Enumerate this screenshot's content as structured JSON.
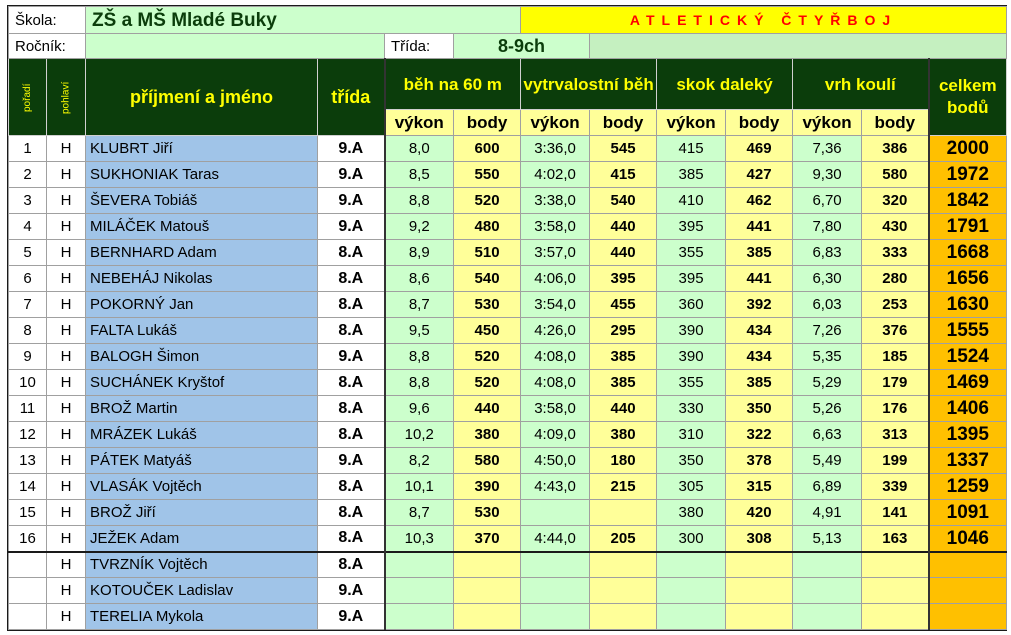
{
  "header": {
    "school_label": "Škola:",
    "school_name": "ZŠ a MŠ Mladé Buky",
    "title": "ATLETICKÝ ČTYŘBOJ",
    "year_label": "Ročník:",
    "class_label": "Třída:",
    "class_value": "8-9ch"
  },
  "columns": {
    "rank": "pořadí",
    "sex": "pohlaví",
    "name": "příjmení a jméno",
    "class": "třída",
    "ev1": "běh na 60 m",
    "ev2": "vytrvalostní běh",
    "ev3": "skok daleký",
    "ev4": "vrh koulí",
    "total": "celkem bodů",
    "perf": "výkon",
    "pts": "body"
  },
  "rows": [
    {
      "rank": "1",
      "sex": "H",
      "name": "KLUBRT Jiří",
      "cls": "9.A",
      "p1": "8,0",
      "b1": "600",
      "p2": "3:36,0",
      "b2": "545",
      "p3": "415",
      "b3": "469",
      "p4": "7,36",
      "b4": "386",
      "total": "2000"
    },
    {
      "rank": "2",
      "sex": "H",
      "name": "SUKHONIAK Taras",
      "cls": "9.A",
      "p1": "8,5",
      "b1": "550",
      "p2": "4:02,0",
      "b2": "415",
      "p3": "385",
      "b3": "427",
      "p4": "9,30",
      "b4": "580",
      "total": "1972"
    },
    {
      "rank": "3",
      "sex": "H",
      "name": "ŠEVERA Tobiáš",
      "cls": "9.A",
      "p1": "8,8",
      "b1": "520",
      "p2": "3:38,0",
      "b2": "540",
      "p3": "410",
      "b3": "462",
      "p4": "6,70",
      "b4": "320",
      "total": "1842"
    },
    {
      "rank": "4",
      "sex": "H",
      "name": "MILÁČEK Matouš",
      "cls": "9.A",
      "p1": "9,2",
      "b1": "480",
      "p2": "3:58,0",
      "b2": "440",
      "p3": "395",
      "b3": "441",
      "p4": "7,80",
      "b4": "430",
      "total": "1791"
    },
    {
      "rank": "5",
      "sex": "H",
      "name": "BERNHARD Adam",
      "cls": "8.A",
      "p1": "8,9",
      "b1": "510",
      "p2": "3:57,0",
      "b2": "440",
      "p3": "355",
      "b3": "385",
      "p4": "6,83",
      "b4": "333",
      "total": "1668"
    },
    {
      "rank": "6",
      "sex": "H",
      "name": "NEBEHÁJ Nikolas",
      "cls": "8.A",
      "p1": "8,6",
      "b1": "540",
      "p2": "4:06,0",
      "b2": "395",
      "p3": "395",
      "b3": "441",
      "p4": "6,30",
      "b4": "280",
      "total": "1656"
    },
    {
      "rank": "7",
      "sex": "H",
      "name": "POKORNÝ Jan",
      "cls": "8.A",
      "p1": "8,7",
      "b1": "530",
      "p2": "3:54,0",
      "b2": "455",
      "p3": "360",
      "b3": "392",
      "p4": "6,03",
      "b4": "253",
      "total": "1630"
    },
    {
      "rank": "8",
      "sex": "H",
      "name": "FALTA Lukáš",
      "cls": "8.A",
      "p1": "9,5",
      "b1": "450",
      "p2": "4:26,0",
      "b2": "295",
      "p3": "390",
      "b3": "434",
      "p4": "7,26",
      "b4": "376",
      "total": "1555"
    },
    {
      "rank": "9",
      "sex": "H",
      "name": "BALOGH Šimon",
      "cls": "9.A",
      "p1": "8,8",
      "b1": "520",
      "p2": "4:08,0",
      "b2": "385",
      "p3": "390",
      "b3": "434",
      "p4": "5,35",
      "b4": "185",
      "total": "1524"
    },
    {
      "rank": "10",
      "sex": "H",
      "name": "SUCHÁNEK Kryštof",
      "cls": "8.A",
      "p1": "8,8",
      "b1": "520",
      "p2": "4:08,0",
      "b2": "385",
      "p3": "355",
      "b3": "385",
      "p4": "5,29",
      "b4": "179",
      "total": "1469"
    },
    {
      "rank": "11",
      "sex": "H",
      "name": "BROŽ Martin",
      "cls": "8.A",
      "p1": "9,6",
      "b1": "440",
      "p2": "3:58,0",
      "b2": "440",
      "p3": "330",
      "b3": "350",
      "p4": "5,26",
      "b4": "176",
      "total": "1406"
    },
    {
      "rank": "12",
      "sex": "H",
      "name": "MRÁZEK Lukáš",
      "cls": "8.A",
      "p1": "10,2",
      "b1": "380",
      "p2": "4:09,0",
      "b2": "380",
      "p3": "310",
      "b3": "322",
      "p4": "6,63",
      "b4": "313",
      "total": "1395"
    },
    {
      "rank": "13",
      "sex": "H",
      "name": "PÁTEK Matyáš",
      "cls": "9.A",
      "p1": "8,2",
      "b1": "580",
      "p2": "4:50,0",
      "b2": "180",
      "p3": "350",
      "b3": "378",
      "p4": "5,49",
      "b4": "199",
      "total": "1337"
    },
    {
      "rank": "14",
      "sex": "H",
      "name": "VLASÁK Vojtěch",
      "cls": "8.A",
      "p1": "10,1",
      "b1": "390",
      "p2": "4:43,0",
      "b2": "215",
      "p3": "305",
      "b3": "315",
      "p4": "6,89",
      "b4": "339",
      "total": "1259"
    },
    {
      "rank": "15",
      "sex": "H",
      "name": "BROŽ Jiří",
      "cls": "8.A",
      "p1": "8,7",
      "b1": "530",
      "p2": "",
      "b2": "",
      "p3": "380",
      "b3": "420",
      "p4": "4,91",
      "b4": "141",
      "total": "1091"
    },
    {
      "rank": "16",
      "sex": "H",
      "name": "JEŽEK Adam",
      "cls": "8.A",
      "p1": "10,3",
      "b1": "370",
      "p2": "4:44,0",
      "b2": "205",
      "p3": "300",
      "b3": "308",
      "p4": "5,13",
      "b4": "163",
      "total": "1046"
    }
  ],
  "extra_rows": [
    {
      "rank": "",
      "sex": "H",
      "name": "TVRZNÍK Vojtěch",
      "cls": "8.A"
    },
    {
      "rank": "",
      "sex": "H",
      "name": "KOTOUČEK Ladislav",
      "cls": "9.A"
    },
    {
      "rank": "",
      "sex": "H",
      "name": "TERELIA Mykola",
      "cls": "9.A"
    }
  ]
}
